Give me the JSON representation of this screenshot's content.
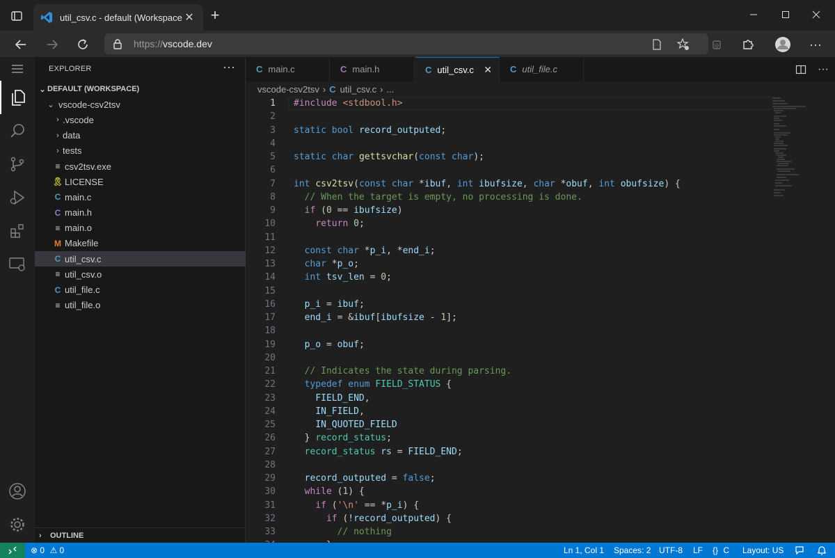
{
  "browser": {
    "tab_title": "util_csv.c - default (Workspace) -",
    "url_prefix": "https://",
    "url_domain": "vscode.dev"
  },
  "sidebar": {
    "title": "EXPLORER",
    "workspace": "DEFAULT (WORKSPACE)",
    "folder": "vscode-csv2tsv",
    "items": [
      {
        "label": ".vscode",
        "type": "folder"
      },
      {
        "label": "data",
        "type": "folder"
      },
      {
        "label": "tests",
        "type": "folder"
      },
      {
        "label": "csv2tsv.exe",
        "type": "file"
      },
      {
        "label": "LICENSE",
        "type": "license"
      },
      {
        "label": "main.c",
        "type": "c"
      },
      {
        "label": "main.h",
        "type": "h"
      },
      {
        "label": "main.o",
        "type": "file"
      },
      {
        "label": "Makefile",
        "type": "makefile"
      },
      {
        "label": "util_csv.c",
        "type": "c"
      },
      {
        "label": "util_csv.o",
        "type": "file"
      },
      {
        "label": "util_file.c",
        "type": "c"
      },
      {
        "label": "util_file.o",
        "type": "file"
      }
    ],
    "outline": "OUTLINE"
  },
  "editor": {
    "tabs": [
      {
        "label": "main.c",
        "icon": "C"
      },
      {
        "label": "main.h",
        "icon": "C"
      },
      {
        "label": "util_csv.c",
        "icon": "C"
      },
      {
        "label": "util_file.c",
        "icon": "C"
      }
    ],
    "breadcrumb": {
      "folder": "vscode-csv2tsv",
      "file": "util_csv.c",
      "more": "..."
    }
  },
  "statusbar": {
    "errors": "0",
    "warnings": "0",
    "position": "Ln 1, Col 1",
    "spaces": "Spaces: 2",
    "encoding": "UTF-8",
    "eol": "LF",
    "language": "C",
    "layout": "Layout: US"
  },
  "colors": {
    "accent": "#0078d4",
    "remote": "#16825d",
    "keyword": "#569cd6",
    "comment": "#6a9955"
  }
}
